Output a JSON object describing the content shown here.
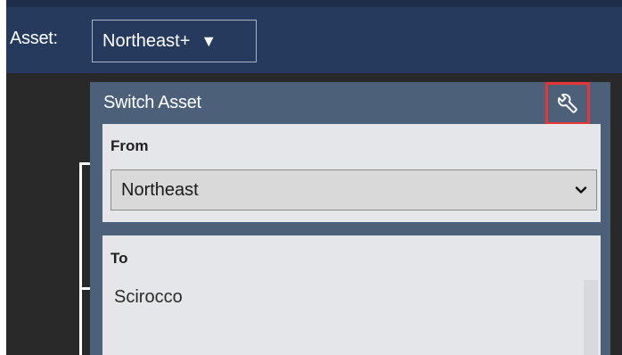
{
  "header": {
    "asset_label": "Asset:",
    "asset_value": "Northeast+",
    "asset_caret": "▼"
  },
  "panel": {
    "title": "Switch Asset",
    "tool_icon": "wrench-icon",
    "from": {
      "label": "From",
      "selected": "Northeast"
    },
    "to": {
      "label": "To",
      "items": [
        "Scirocco"
      ]
    }
  },
  "colors": {
    "topbar": "#263a5d",
    "panel": "#4c6079",
    "section": "#e4e6e9",
    "highlight": "#e53535",
    "background": "#292929"
  }
}
